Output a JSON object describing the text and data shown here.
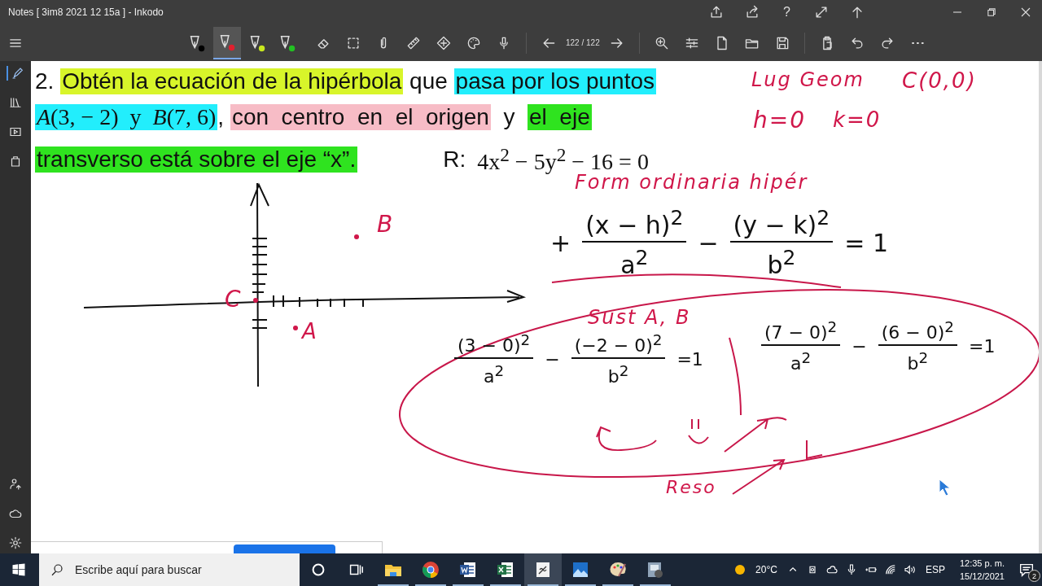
{
  "window": {
    "title": "Notes [ 3im8 2021 12 15a ] - Inkodo",
    "help": "?"
  },
  "toolbar": {
    "pens": [
      {
        "color": "#000000",
        "selected": false
      },
      {
        "color": "#e0202e",
        "selected": true
      },
      {
        "color": "#c8e81e",
        "selected": false
      },
      {
        "color": "#22c022",
        "selected": false
      }
    ],
    "page_indicator": "122 / 122"
  },
  "problem": {
    "lines": [
      [
        {
          "kind": "text",
          "text": "2. "
        },
        {
          "kind": "text",
          "text": "Obtén la ecuación de la hipérbola",
          "color": "#d8f52a"
        },
        {
          "kind": "text",
          "text": " que "
        },
        {
          "kind": "text",
          "text": "pasa por los puntos",
          "color": "#22eefc"
        }
      ],
      [
        {
          "kind": "math",
          "text": "*A*(3, − 2)  y  *B*(7, 6)",
          "color": "#22eefc"
        },
        {
          "kind": "text",
          "text": ", "
        },
        {
          "kind": "text",
          "text": "con  centro  en  el  origen",
          "color": "#f7bcc6"
        },
        {
          "kind": "text",
          "text": "  y  "
        },
        {
          "kind": "text",
          "text": "el  eje",
          "color": "#2fe31f"
        }
      ],
      [
        {
          "kind": "text",
          "text": "transverso está sobre el eje “x”.",
          "color": "#2fe31f"
        }
      ]
    ],
    "answer_label": "R:",
    "answer": "4x$^{2}$ − 5y$^{2}$ − 16 = 0"
  },
  "notes": [
    {
      "kind": "text",
      "text": "Lug Geom",
      "color": "#d0174a"
    },
    {
      "kind": "text",
      "text": "C(0,0)",
      "color": "#d0174a"
    },
    {
      "kind": "text",
      "text": "h=0",
      "color": "#d0174a"
    },
    {
      "kind": "text",
      "text": "k=0",
      "color": "#d0174a"
    },
    {
      "kind": "text",
      "text": "Form ordinaria hipér",
      "color": "#d0174a"
    },
    {
      "kind": "equation",
      "color": "#111111",
      "terms": [
        {
          "kind": "op",
          "text": "+"
        },
        {
          "kind": "frac",
          "num": "(x − h)$^{2}$",
          "den": "a$^{2}$"
        },
        {
          "kind": "op",
          "text": "−"
        },
        {
          "kind": "frac",
          "num": "(y − k)$^{2}$",
          "den": "b$^{2}$"
        },
        {
          "kind": "op",
          "text": "= 1"
        }
      ]
    },
    {
      "kind": "text",
      "text": "Sust A, B",
      "color": "#d0174a"
    },
    {
      "kind": "equation",
      "color": "#111111",
      "terms": [
        {
          "kind": "frac",
          "num": "(3 − 0)$^{2}$",
          "den": "a$^{2}$"
        },
        {
          "kind": "op",
          "text": "−"
        },
        {
          "kind": "frac",
          "num": "(−2 − 0)$^{2}$",
          "den": "b$^{2}$"
        },
        {
          "kind": "op",
          "text": "=1"
        }
      ]
    },
    {
      "kind": "equation",
      "color": "#111111",
      "terms": [
        {
          "kind": "frac",
          "num": "(7 − 0)$^{2}$",
          "den": "a$^{2}$"
        },
        {
          "kind": "op",
          "text": "−"
        },
        {
          "kind": "frac",
          "num": "(6 − 0)$^{2}$",
          "den": "b$^{2}$"
        },
        {
          "kind": "op",
          "text": "=1"
        }
      ]
    },
    {
      "kind": "text",
      "text": "Reso",
      "color": "#d0174a"
    },
    {
      "kind": "text",
      "text": "B",
      "color": "#d0174a"
    },
    {
      "kind": "text",
      "text": "A",
      "color": "#d0174a"
    },
    {
      "kind": "text",
      "text": "C",
      "color": "#d0174a"
    }
  ],
  "taskbar": {
    "search": {
      "placeholder": "Escribe aquí para buscar"
    },
    "apps": [
      {
        "kind": "explorer",
        "selected": false
      },
      {
        "kind": "chrome",
        "selected": false
      },
      {
        "kind": "word",
        "selected": false
      },
      {
        "kind": "excel",
        "selected": false
      },
      {
        "kind": "inkodo",
        "selected": true
      },
      {
        "kind": "photos",
        "selected": false
      },
      {
        "kind": "paint",
        "selected": false
      },
      {
        "kind": "media",
        "selected": false
      }
    ],
    "temperature": "20°C",
    "language": "ESP",
    "time": "12:35 p. m.",
    "date": "15/12/2021",
    "notifications": "2"
  }
}
